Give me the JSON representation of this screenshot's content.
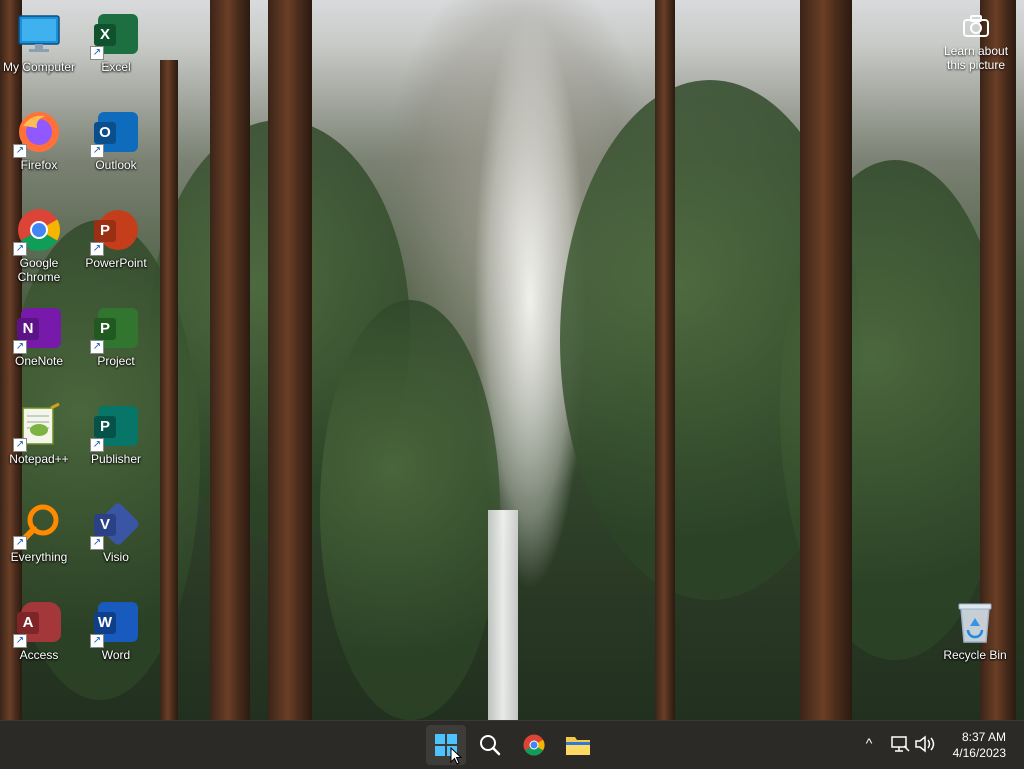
{
  "desktop": {
    "icons": [
      {
        "label": "My Computer",
        "icon": "monitor-icon"
      },
      {
        "label": "Excel",
        "icon": "excel-icon",
        "letter": "X"
      },
      {
        "label": "Firefox",
        "icon": "firefox-icon"
      },
      {
        "label": "Outlook",
        "icon": "outlook-icon",
        "letter": "O"
      },
      {
        "label": "Google Chrome",
        "icon": "chrome-icon"
      },
      {
        "label": "PowerPoint",
        "icon": "powerpoint-icon",
        "letter": "P"
      },
      {
        "label": "OneNote",
        "icon": "onenote-icon",
        "letter": "N"
      },
      {
        "label": "Project",
        "icon": "project-icon",
        "letter": "P"
      },
      {
        "label": "Notepad++",
        "icon": "notepadpp-icon"
      },
      {
        "label": "Publisher",
        "icon": "publisher-icon",
        "letter": "P"
      },
      {
        "label": "Everything",
        "icon": "everything-icon"
      },
      {
        "label": "Visio",
        "icon": "visio-icon",
        "letter": "V"
      },
      {
        "label": "Access",
        "icon": "access-icon",
        "letter": "A"
      },
      {
        "label": "Word",
        "icon": "word-icon",
        "letter": "W"
      },
      {
        "label": "Recycle Bin",
        "icon": "recycle-bin-icon"
      }
    ],
    "learn_picture": {
      "label_line1": "Learn about",
      "label_line2": "this picture",
      "icon": "camera-icon"
    },
    "shortcut_glyph": "↗"
  },
  "taskbar": {
    "apps": [
      {
        "name": "Start",
        "icon": "windows-start-icon"
      },
      {
        "name": "Search",
        "icon": "search-icon"
      },
      {
        "name": "Google Chrome",
        "icon": "chrome-icon"
      },
      {
        "name": "File Explorer",
        "icon": "folder-icon"
      }
    ],
    "tray": {
      "chevron": "^",
      "time": "8:37 AM",
      "date": "4/16/2023"
    }
  },
  "colors": {
    "excel": "#1d6f42",
    "outlook": "#0f6cbd",
    "powerpoint": "#c43e1c",
    "onenote": "#7719aa",
    "project": "#31752f",
    "publisher": "#077568",
    "visio": "#3955a3",
    "access": "#a4373a",
    "word": "#185abd"
  }
}
